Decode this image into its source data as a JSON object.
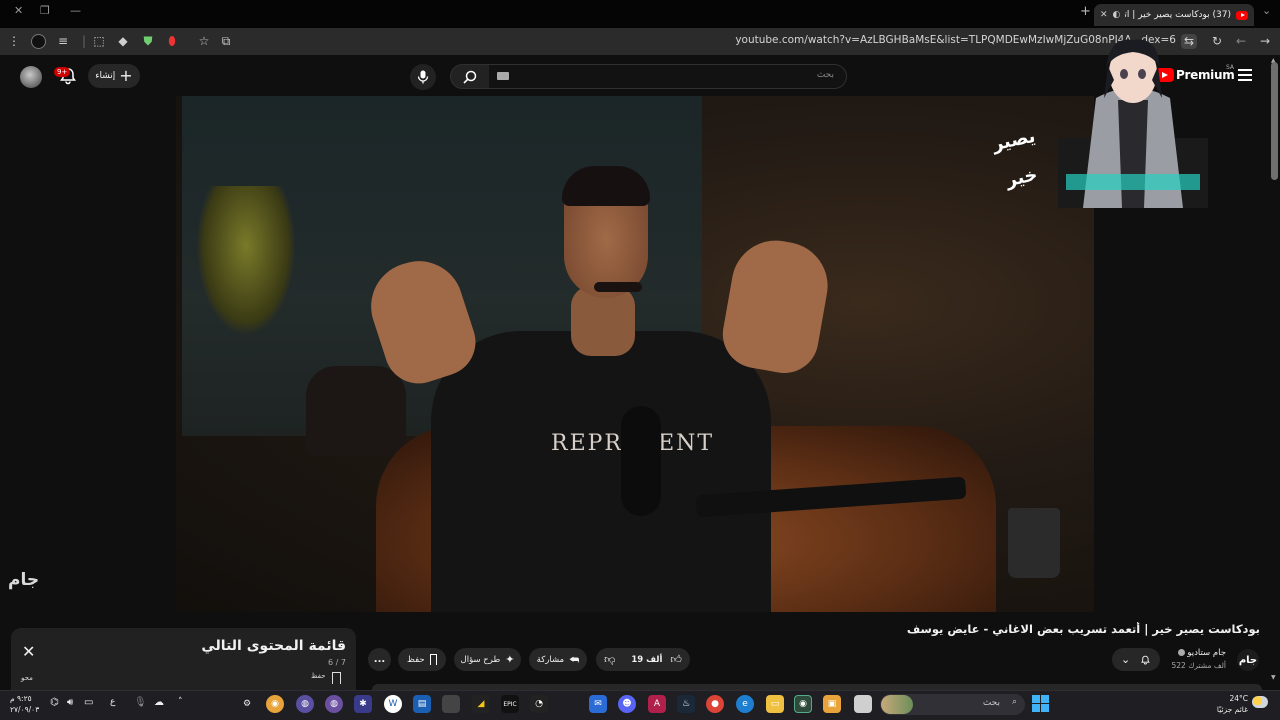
{
  "browser": {
    "tab_title": "(37) بودكاست يصير خير | أتعـ",
    "new_tab": "+",
    "url": "youtube.com/watch?v=AzLBGHBaMsE&list=TLPQMDEwMzIwMjZuG08nPI4A...dex=6"
  },
  "masthead": {
    "logo_text": "Premium",
    "region": "SA",
    "search_placeholder": "بحث",
    "create_label": "إنشاء",
    "notification_count": "9+"
  },
  "video": {
    "title": "بودكاست يصير خير | أتعمد تسريب بعض الاغاني - عايض يوسف",
    "overlay_logo": "يصير خير",
    "studio_watermark": "جام"
  },
  "channel": {
    "avatar_text": "جام",
    "name": "جام ستاديو",
    "subscribers": "522 ألف مشترك"
  },
  "actions": {
    "likes": "19 ألف",
    "share": "مشاركة",
    "ask": "طرح سؤال",
    "save": "حفظ",
    "more": "..."
  },
  "playlist": {
    "title": "قائمة المحتوى التالي",
    "count": "6 / 7",
    "save": "حفظ",
    "other": "محو"
  },
  "taskbar": {
    "search_label": "بحث",
    "weather_temp": "24°C",
    "weather_desc": "غائم جزئيًا",
    "time": "٩:٢٥ م",
    "date": "٢٧/٠٩/٠٣",
    "lang": "ع",
    "colors": {
      "accent": "#3fb3f5"
    }
  }
}
